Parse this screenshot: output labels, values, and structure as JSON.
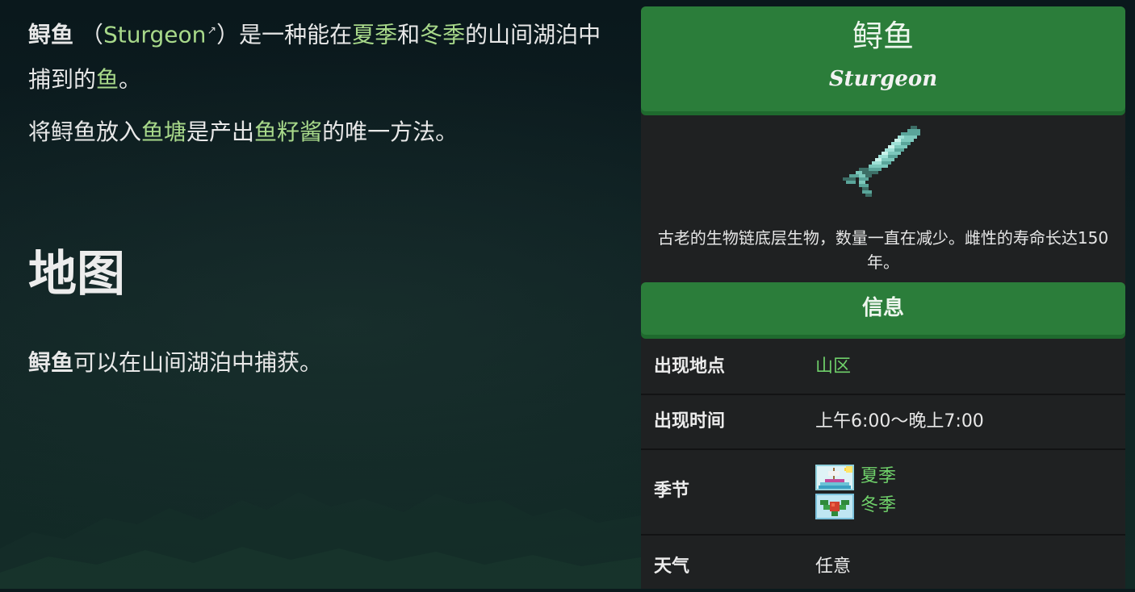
{
  "article": {
    "name_bold": "鲟鱼",
    "paren_open": "（",
    "english_link": "Sturgeon",
    "paren_close": "）",
    "intro_pre": "是一种能在",
    "link_summer": "夏季",
    "intro_and": "和",
    "link_winter": "冬季",
    "intro_mid": "的山间湖泊中捕到的",
    "link_fish": "鱼",
    "intro_end": "。",
    "p2_pre": "将鲟鱼放入",
    "link_pond": "鱼塘",
    "p2_mid": "是产出",
    "link_caviar": "鱼籽酱",
    "p2_end": "的唯一方法。",
    "heading_map": "地图",
    "p3_link": "鲟鱼",
    "p3_text": "可以在山间湖泊中捕获。"
  },
  "infobox": {
    "title": "鲟鱼",
    "subtitle": "Sturgeon",
    "description": "古老的生物链底层生物，数量一直在减少。雌性的寿命长达150年。",
    "section_title": "信息",
    "rows": [
      {
        "key": "出现地点",
        "value": "山区"
      },
      {
        "key": "出现时间",
        "value": "上午6:00～晚上7:00"
      },
      {
        "key": "季节",
        "seasons": [
          "夏季",
          "冬季"
        ]
      },
      {
        "key": "天气",
        "value": "任意"
      }
    ]
  },
  "colors": {
    "link": "#a8d98a",
    "accent_green": "#2b7d3a",
    "value_green": "#6fd06a",
    "panel_bg": "#1f2122"
  },
  "icons": [
    "external-link-icon",
    "sturgeon-fish-icon",
    "summer-season-icon",
    "winter-season-icon"
  ]
}
